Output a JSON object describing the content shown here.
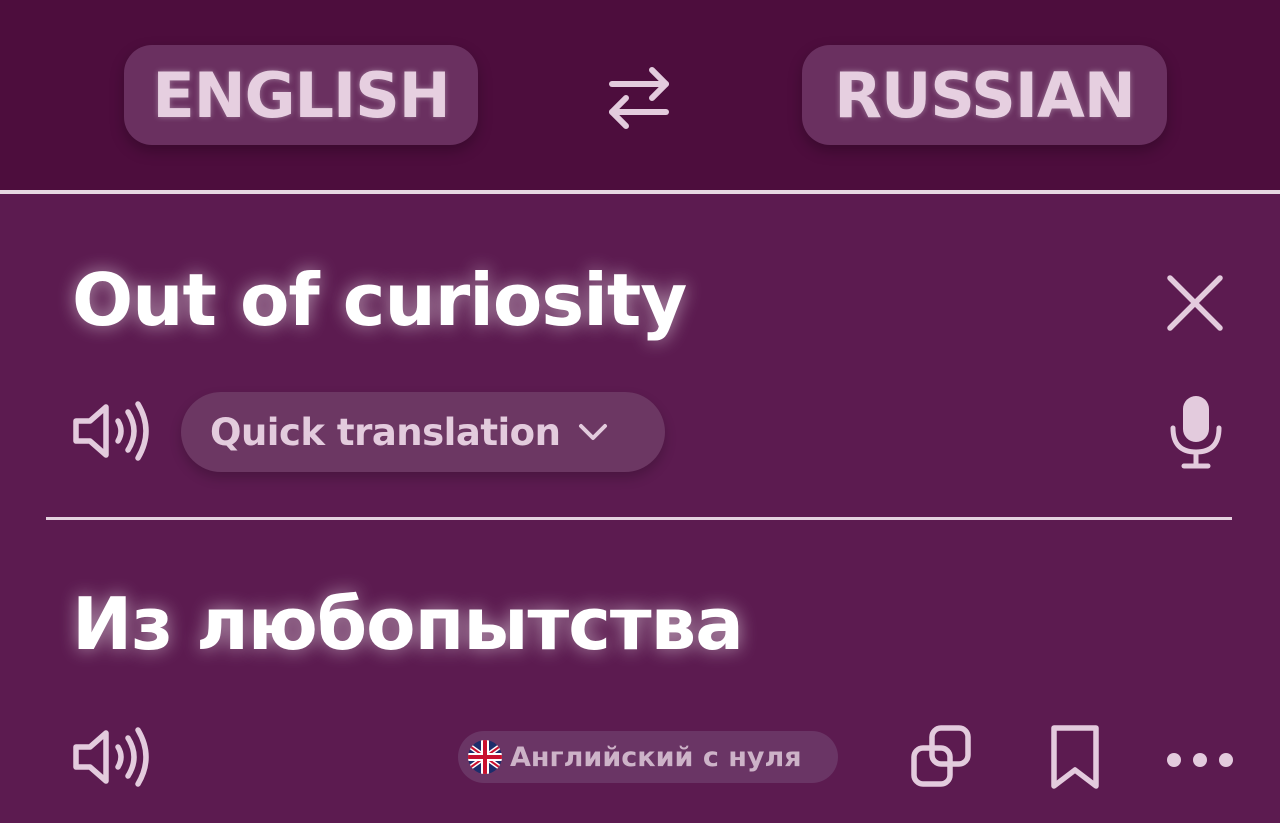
{
  "header": {
    "source_language": "ENGLISH",
    "target_language": "RUSSIAN",
    "swap_icon": "swap-arrows-icon"
  },
  "source": {
    "text": "Out of curiosity",
    "mode_label": "Quick translation",
    "icons": [
      "speaker-icon",
      "close-icon",
      "chevron-down-icon",
      "microphone-icon"
    ]
  },
  "translation": {
    "text": "Из любопытства",
    "watermark": "Английский с нуля",
    "icons": [
      "speaker-icon",
      "uk-flag-icon",
      "copy-icon",
      "bookmark-icon",
      "more-icon"
    ]
  },
  "colors": {
    "header_bg": "#4d0d3d",
    "body_bg": "#5c1b50",
    "pill_bg": "#6a3060",
    "icon_color": "#e3cbdd",
    "text_color": "#ffffff"
  }
}
